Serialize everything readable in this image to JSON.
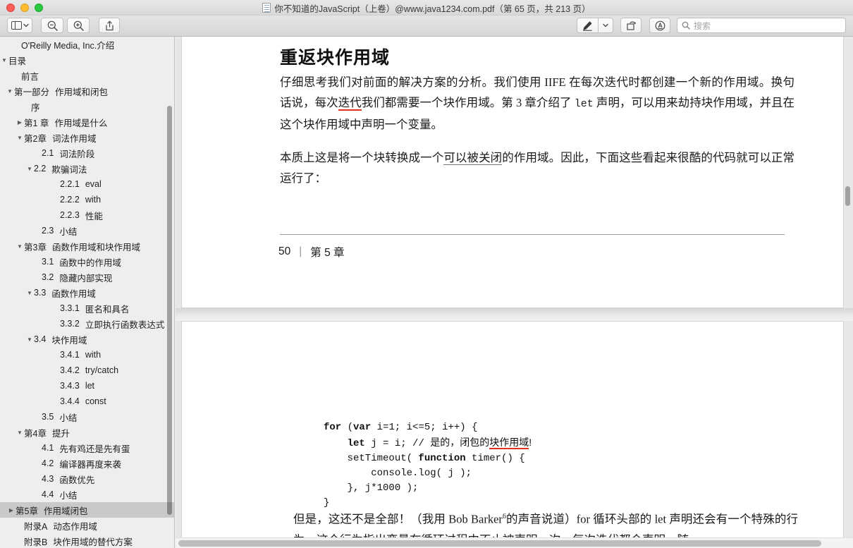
{
  "window": {
    "title": "你不知道的JavaScript（上卷）@www.java1234.com.pdf（第 65 页，共 213 页）",
    "doc_icon": "pdf-document-icon",
    "traffic_lights": [
      "close",
      "minimize",
      "zoom"
    ]
  },
  "toolbar": {
    "sidebar_toggle": "sidebar-toggle",
    "sidebar_caret": "chevron-down-icon",
    "zoom_out": "zoom-out-icon",
    "zoom_in": "zoom-in-icon",
    "share": "share-icon",
    "markup": "markup-pen-icon",
    "markup_caret": "chevron-down-icon",
    "rotate": "rotate-icon",
    "annotate": "annotate-icon",
    "search_placeholder": "搜索",
    "search_value": "",
    "search_icon": "search-icon"
  },
  "sidebar": {
    "items": [
      {
        "tri": "none",
        "indent": 30,
        "num": "",
        "label": "O'Reilly Media, Inc.介绍"
      },
      {
        "tri": "down",
        "indent": 8,
        "num": "",
        "label": "目录"
      },
      {
        "tri": "none",
        "indent": 30,
        "num": "",
        "label": "前言"
      },
      {
        "tri": "down",
        "indent": 20,
        "num": "第一部分",
        "label": "作用域和闭包"
      },
      {
        "tri": "none",
        "indent": 44,
        "num": "",
        "label": "序"
      },
      {
        "tri": "right",
        "indent": 34,
        "num": "第1 章",
        "label": "作用域是什么"
      },
      {
        "tri": "down",
        "indent": 34,
        "num": "第2章",
        "label": "词法作用域"
      },
      {
        "tri": "none",
        "indent": 59,
        "num": "2.1",
        "label": "词法阶段"
      },
      {
        "tri": "down",
        "indent": 48,
        "num": "2.2",
        "label": "欺骗词法"
      },
      {
        "tri": "none",
        "indent": 85,
        "num": "2.2.1",
        "label": "eval"
      },
      {
        "tri": "none",
        "indent": 85,
        "num": "2.2.2",
        "label": "with"
      },
      {
        "tri": "none",
        "indent": 85,
        "num": "2.2.3",
        "label": "性能"
      },
      {
        "tri": "none",
        "indent": 59,
        "num": "2.3",
        "label": "小结"
      },
      {
        "tri": "down",
        "indent": 34,
        "num": "第3章",
        "label": "函数作用域和块作用域"
      },
      {
        "tri": "none",
        "indent": 59,
        "num": "3.1",
        "label": "函数中的作用域"
      },
      {
        "tri": "none",
        "indent": 59,
        "num": "3.2",
        "label": "隐藏内部实现"
      },
      {
        "tri": "down",
        "indent": 48,
        "num": "3.3",
        "label": "函数作用域"
      },
      {
        "tri": "none",
        "indent": 85,
        "num": "3.3.1",
        "label": "匿名和具名"
      },
      {
        "tri": "none",
        "indent": 85,
        "num": "3.3.2",
        "label": "立即执行函数表达式"
      },
      {
        "tri": "down",
        "indent": 48,
        "num": "3.4",
        "label": "块作用域"
      },
      {
        "tri": "none",
        "indent": 85,
        "num": "3.4.1",
        "label": "with"
      },
      {
        "tri": "none",
        "indent": 85,
        "num": "3.4.2",
        "label": "try/catch"
      },
      {
        "tri": "none",
        "indent": 85,
        "num": "3.4.3",
        "label": "let"
      },
      {
        "tri": "none",
        "indent": 85,
        "num": "3.4.4",
        "label": "const"
      },
      {
        "tri": "none",
        "indent": 59,
        "num": "3.5",
        "label": "小结"
      },
      {
        "tri": "down",
        "indent": 34,
        "num": "第4章",
        "label": "提升"
      },
      {
        "tri": "none",
        "indent": 59,
        "num": "4.1",
        "label": "先有鸡还是先有蛋"
      },
      {
        "tri": "none",
        "indent": 59,
        "num": "4.2",
        "label": "编译器再度来袭"
      },
      {
        "tri": "none",
        "indent": 59,
        "num": "4.3",
        "label": "函数优先"
      },
      {
        "tri": "none",
        "indent": 59,
        "num": "4.4",
        "label": "小结"
      },
      {
        "tri": "right",
        "indent": 22,
        "num": "第5章",
        "label": "作用域闭包",
        "selected": true
      },
      {
        "tri": "none",
        "indent": 34,
        "num": "附录A",
        "label": "动态作用域"
      },
      {
        "tri": "none",
        "indent": 34,
        "num": "附录B",
        "label": "块作用域的替代方案"
      }
    ]
  },
  "page1": {
    "heading": "重返块作用域",
    "para1_a": "仔细思考我们对前面的解决方案的分析。我们使用 IIFE 在每次迭代时都创建一个新的作用域。换句话说，每次",
    "para1_underline": "迭代",
    "para1_b": "我们都需要一个块作用域。第 3 章介绍了 ",
    "para1_mono": "let",
    "para1_c": " 声明，可以用来劫持块作用域，并且在这个块作用域中声明一个变量。",
    "para2_a": "本质上这是",
    "para2_red": "将一个块转换成一个",
    "para2_dotted": "可以被关闭",
    "para2_red2": "的作用域",
    "para2_b": "。因此，下面这些看起来很酷的代码就可以正常运行了：",
    "footer_page": "50",
    "footer_sep": "|",
    "footer_chapter": "第 5 章"
  },
  "page2": {
    "code_lines": [
      {
        "parts": [
          {
            "t": "for",
            "b": true
          },
          {
            "t": " ("
          },
          {
            "t": "var",
            "b": true
          },
          {
            "t": " i=1; i<=5; i++) {"
          }
        ]
      },
      {
        "parts": [
          {
            "t": "    "
          },
          {
            "t": "let",
            "b": true
          },
          {
            "t": " j = i; // "
          },
          {
            "t": "是的，闭包的",
            "cn": true
          },
          {
            "t": "块作用域",
            "cn": true,
            "u": true
          },
          {
            "t": "!",
            "cn": true
          }
        ]
      },
      {
        "parts": [
          {
            "t": "    setTimeout( "
          },
          {
            "t": "function",
            "b": true
          },
          {
            "t": " timer() {"
          }
        ]
      },
      {
        "parts": [
          {
            "t": "        console.log( j );"
          }
        ]
      },
      {
        "parts": [
          {
            "t": "    }, j*1000 );"
          }
        ]
      },
      {
        "parts": [
          {
            "t": "}"
          }
        ]
      }
    ],
    "para_a": "但是，这还不是全部！（我用 Bob Barker",
    "para_sup": "6",
    "para_b": "的声音说道）for 循环头部的 let 声明还会有一个特殊的行为。这个行为指出变量在循环过程中不止被声明一次，每次迭代都会声明。随"
  }
}
